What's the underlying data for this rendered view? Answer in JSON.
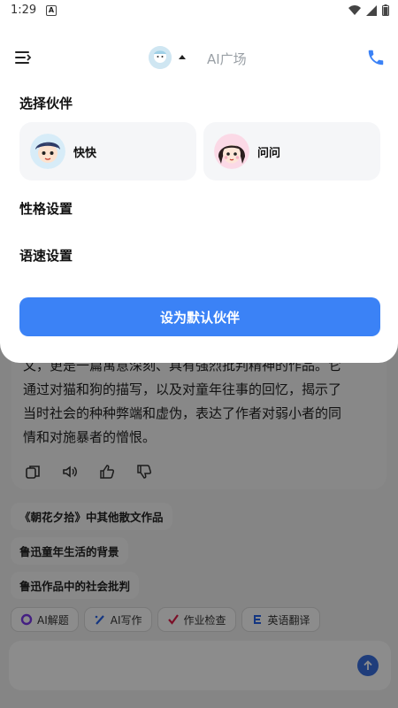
{
  "status_bar": {
    "time": "1:29",
    "notif_letter": "A"
  },
  "header": {
    "plaza_label": "AI广场"
  },
  "sheet": {
    "select_partner_label": "选择伙伴",
    "partners": [
      {
        "name": "快快"
      },
      {
        "name": "问问"
      }
    ],
    "personality_label": "性格设置",
    "speed_label": "语速设置",
    "cta_label": "设为默认伙伴"
  },
  "background": {
    "answer_text": "文，更是一篇寓意深刻、具有强烈批判精神的作品。它\n通过对猫和狗的描写，以及对童年往事的回忆，揭示了\n当时社会的种种弊端和虚伪，表达了作者对弱小者的同\n情和对施暴者的憎恨。",
    "suggestions": [
      "《朝花夕拾》中其他散文作品",
      "鲁迅童年生活的背景",
      "鲁迅作品中的社会批判"
    ],
    "tools": [
      {
        "label": "AI解题",
        "icon": "ai-solve-icon"
      },
      {
        "label": "AI写作",
        "icon": "ai-write-icon"
      },
      {
        "label": "作业检查",
        "icon": "check-icon"
      },
      {
        "label": "英语翻译",
        "icon": "translate-icon"
      }
    ]
  },
  "colors": {
    "accent": "#3b82f6",
    "phone": "#3b82f6"
  }
}
